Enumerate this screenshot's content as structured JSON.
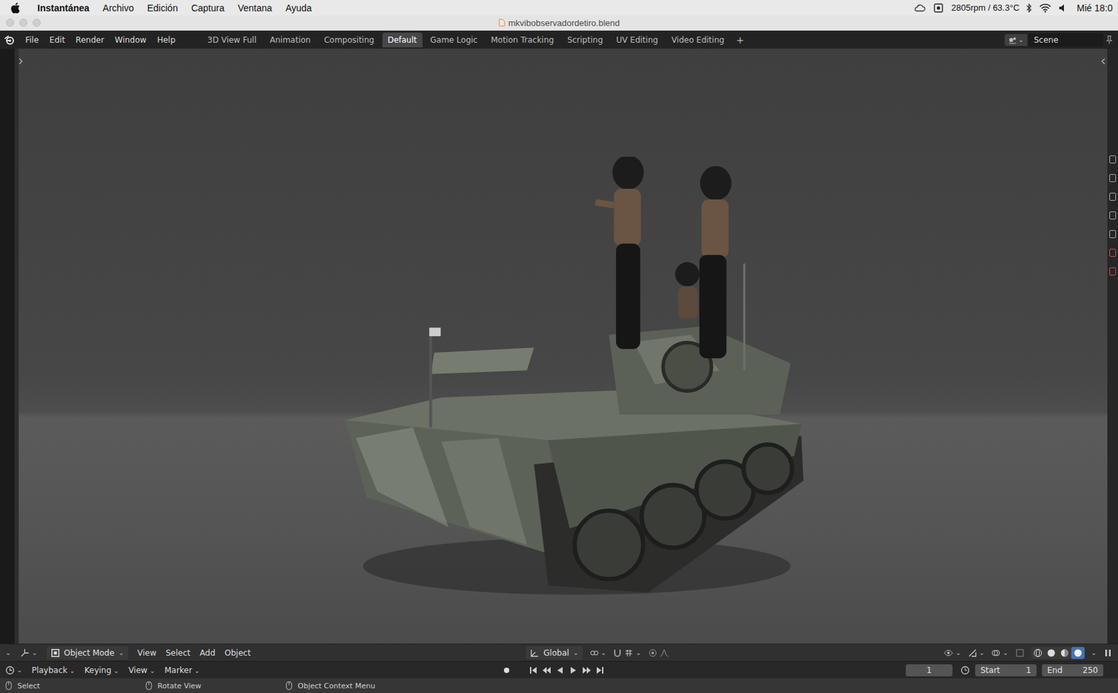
{
  "menubar": {
    "app": "Instantánea",
    "items": [
      "Archivo",
      "Edición",
      "Captura",
      "Ventana",
      "Ayuda"
    ],
    "stats": "2805rpm / 63.3°C",
    "clock": "Mié 18:0"
  },
  "window": {
    "title": "mkvibobservadordetiro.blend"
  },
  "topbar": {
    "menus": [
      "File",
      "Edit",
      "Render",
      "Window",
      "Help"
    ],
    "tabs": [
      {
        "label": "3D View Full",
        "selected": false
      },
      {
        "label": "Animation",
        "selected": false
      },
      {
        "label": "Compositing",
        "selected": false
      },
      {
        "label": "Default",
        "selected": true
      },
      {
        "label": "Game Logic",
        "selected": false
      },
      {
        "label": "Motion Tracking",
        "selected": false
      },
      {
        "label": "Scripting",
        "selected": false
      },
      {
        "label": "UV Editing",
        "selected": false
      },
      {
        "label": "Video Editing",
        "selected": false
      }
    ],
    "add_tab": "+",
    "scene": "Scene"
  },
  "viewport_header": {
    "mode": "Object Mode",
    "menus": [
      "View",
      "Select",
      "Add",
      "Object"
    ],
    "orientation": "Global",
    "shading": [
      {
        "kind": "wireframe",
        "selected": false
      },
      {
        "kind": "solid",
        "selected": false
      },
      {
        "kind": "material",
        "selected": false
      },
      {
        "kind": "rendered",
        "selected": true
      }
    ]
  },
  "timeline": {
    "menus": [
      "Playback",
      "Keying",
      "View",
      "Marker"
    ],
    "current_frame": "1",
    "start": {
      "label": "Start",
      "value": "1"
    },
    "end": {
      "label": "End",
      "value": "250"
    }
  },
  "status_bar": [
    "Select",
    "Rotate View",
    "Object Context Menu"
  ]
}
